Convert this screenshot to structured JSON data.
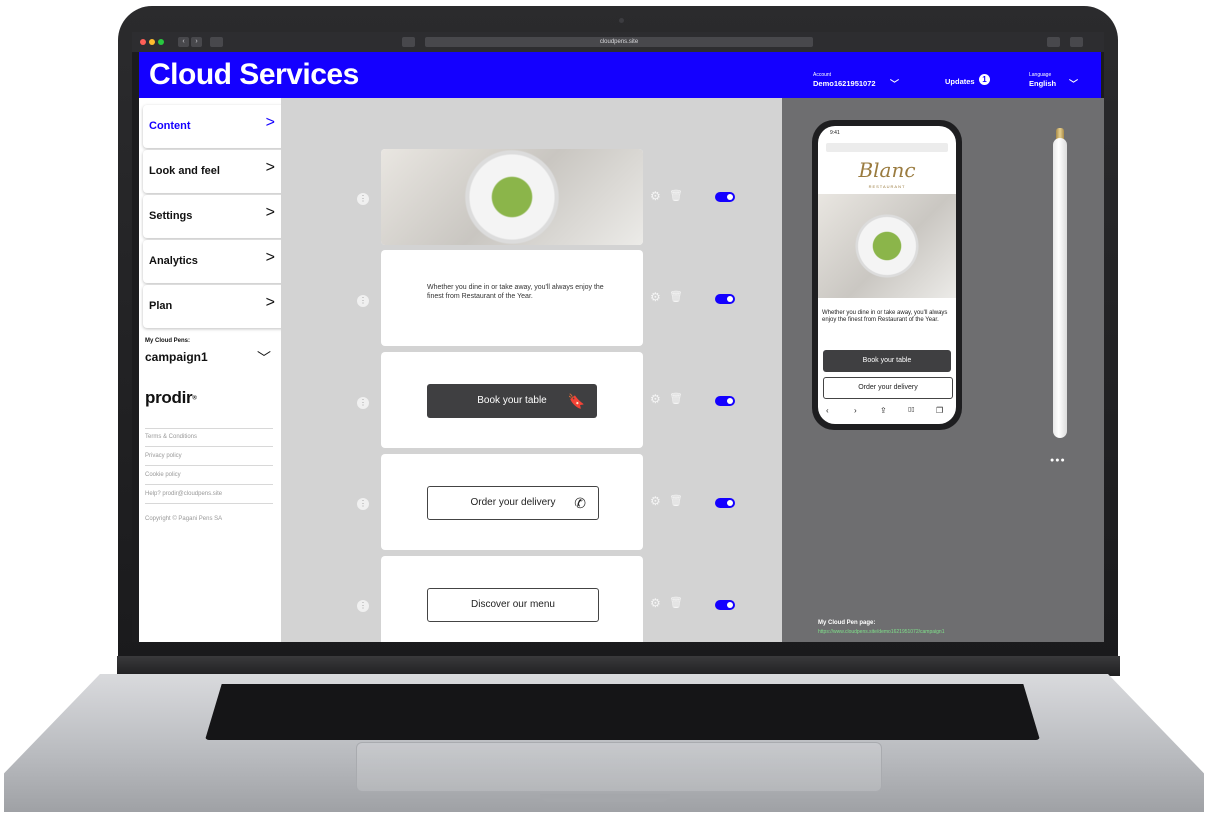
{
  "browser": {
    "url": "cloudpens.site",
    "back_glyph": "‹",
    "forward_glyph": "›"
  },
  "header": {
    "title": "Cloud Services",
    "account_label": "Account",
    "account_value": "Demo1621951072",
    "updates_label": "Updates",
    "updates_count": "1",
    "language_label": "Language",
    "language_value": "English",
    "chevron": "﹀",
    "accent_color": "#1400ff"
  },
  "sidebar": {
    "items": [
      {
        "label": "Content",
        "active": true
      },
      {
        "label": "Look and feel",
        "active": false
      },
      {
        "label": "Settings",
        "active": false
      },
      {
        "label": "Analytics",
        "active": false
      },
      {
        "label": "Plan",
        "active": false
      }
    ],
    "chevron": ">",
    "pens_label": "My Cloud Pens:",
    "pens_value": "campaign1",
    "pens_chevron": "﹀",
    "logo": "prodir",
    "logo_mark": "®",
    "links": [
      "Terms & Conditions",
      "Privacy policy",
      "Cookie policy",
      "Help? prodir@cloudpens.site"
    ],
    "copyright": "Copyright © Pagani Pens SA"
  },
  "content": {
    "text_block": "Whether you dine in or take away, you'll always enjoy the finest from Restaurant of the Year.",
    "book_label": "Book your table",
    "delivery_label": "Order your delivery",
    "menu_label": "Discover our menu",
    "gear_glyph": "⚙",
    "trash_glyph": "🗑",
    "handle_glyph": "⋮",
    "bookmark_glyph": "🔖",
    "phone_glyph": "✆"
  },
  "preview": {
    "time": "9:41",
    "restaurant_logo": "Blanc",
    "restaurant_sub": "RESTAURANT",
    "text_block": "Whether you dine in or take away, you'll always enjoy the finest from Restaurant of the Year.",
    "book_label": "Book your table",
    "delivery_label": "Order your delivery",
    "nav_back": "‹",
    "nav_forward": "›",
    "share_glyph": "⇪",
    "book_glyph": "▯▯",
    "tabs_glyph": "❐",
    "pen_dots": "●●●",
    "page_label": "My Cloud Pen page:",
    "page_link": "https://www.cloudpens.site/demo1621951072/campaign1"
  }
}
